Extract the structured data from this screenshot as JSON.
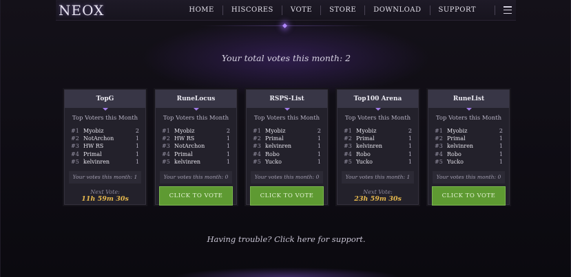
{
  "header": {
    "logo": "NEOX",
    "nav": [
      "HOME",
      "HISCORES",
      "VOTE",
      "STORE",
      "DOWNLOAD",
      "SUPPORT"
    ]
  },
  "total_votes_text": "Your total votes this month: 2",
  "sites": [
    {
      "name": "TopG",
      "subtitle": "Top Voters this Month",
      "voters": [
        {
          "rank": "#1",
          "name": "Myobiz",
          "count": "2"
        },
        {
          "rank": "#2",
          "name": "NotArchon",
          "count": "1"
        },
        {
          "rank": "#3",
          "name": "HW RS",
          "count": "1"
        },
        {
          "rank": "#4",
          "name": "Primal",
          "count": "1"
        },
        {
          "rank": "#5",
          "name": "kelvinren",
          "count": "1"
        }
      ],
      "your_votes": "Your votes this month: 1",
      "next_vote_label": "Next Vote:",
      "next_vote_time": "11h 59m 30s"
    },
    {
      "name": "RuneLocus",
      "subtitle": "Top Voters this Month",
      "voters": [
        {
          "rank": "#1",
          "name": "Myobiz",
          "count": "2"
        },
        {
          "rank": "#2",
          "name": "HW RS",
          "count": "1"
        },
        {
          "rank": "#3",
          "name": "NotArchon",
          "count": "1"
        },
        {
          "rank": "#4",
          "name": "Primal",
          "count": "1"
        },
        {
          "rank": "#5",
          "name": "kelvinren",
          "count": "1"
        }
      ],
      "your_votes": "Your votes this month: 0",
      "button": "CLICK TO VOTE"
    },
    {
      "name": "RSPS-List",
      "subtitle": "Top Voters this Month",
      "voters": [
        {
          "rank": "#1",
          "name": "Myobiz",
          "count": "2"
        },
        {
          "rank": "#2",
          "name": "Primal",
          "count": "1"
        },
        {
          "rank": "#3",
          "name": "kelvinren",
          "count": "1"
        },
        {
          "rank": "#4",
          "name": "Robo",
          "count": "1"
        },
        {
          "rank": "#5",
          "name": "Yucko",
          "count": "1"
        }
      ],
      "your_votes": "Your votes this month: 0",
      "button": "CLICK TO VOTE"
    },
    {
      "name": "Top100 Arena",
      "subtitle": "Top Voters this Month",
      "voters": [
        {
          "rank": "#1",
          "name": "Myobiz",
          "count": "2"
        },
        {
          "rank": "#2",
          "name": "Primal",
          "count": "1"
        },
        {
          "rank": "#3",
          "name": "kelvinren",
          "count": "1"
        },
        {
          "rank": "#4",
          "name": "Robo",
          "count": "1"
        },
        {
          "rank": "#5",
          "name": "Yucko",
          "count": "1"
        }
      ],
      "your_votes": "Your votes this month: 1",
      "next_vote_label": "Next Vote:",
      "next_vote_time": "23h 59m 30s"
    },
    {
      "name": "RuneList",
      "subtitle": "Top Voters this Month",
      "voters": [
        {
          "rank": "#1",
          "name": "Myobiz",
          "count": "2"
        },
        {
          "rank": "#2",
          "name": "Primal",
          "count": "1"
        },
        {
          "rank": "#3",
          "name": "kelvinren",
          "count": "1"
        },
        {
          "rank": "#4",
          "name": "Robo",
          "count": "1"
        },
        {
          "rank": "#5",
          "name": "Yucko",
          "count": "1"
        }
      ],
      "your_votes": "Your votes this month: 0",
      "button": "CLICK TO VOTE"
    }
  ],
  "support_text": "Having trouble? Click here for support.",
  "colors": {
    "accent": "#a07be8",
    "vote_button": "#5e9a32",
    "timer": "#e7b94d"
  }
}
